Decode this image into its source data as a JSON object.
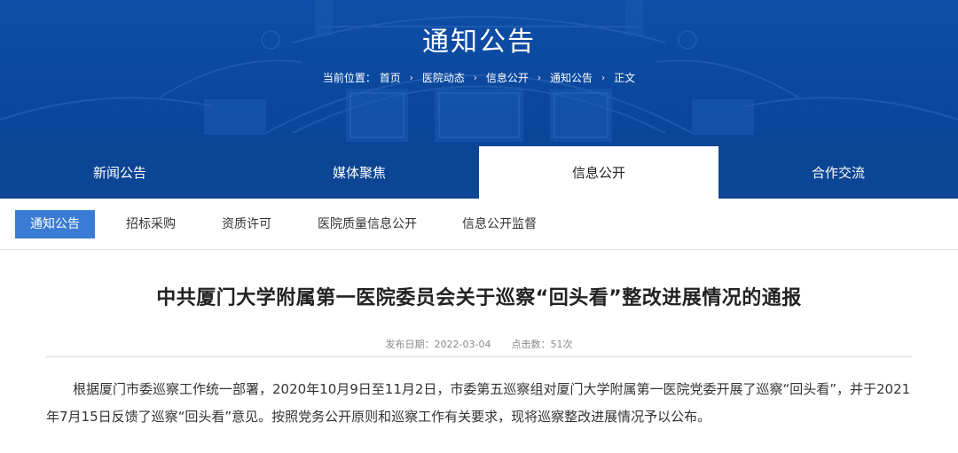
{
  "banner": {
    "title": "通知公告",
    "breadcrumb": {
      "prefix": "当前位置：",
      "items": [
        "首页",
        "医院动态",
        "信息公开",
        "通知公告",
        "正文"
      ]
    }
  },
  "main_nav": {
    "tabs": [
      {
        "label": "新闻公告",
        "active": false
      },
      {
        "label": "媒体聚焦",
        "active": false
      },
      {
        "label": "信息公开",
        "active": true
      },
      {
        "label": "合作交流",
        "active": false
      }
    ]
  },
  "sub_nav": {
    "tabs": [
      {
        "label": "通知公告",
        "active": true
      },
      {
        "label": "招标采购",
        "active": false
      },
      {
        "label": "资质许可",
        "active": false
      },
      {
        "label": "医院质量信息公开",
        "active": false
      },
      {
        "label": "信息公开监督",
        "active": false
      }
    ]
  },
  "article": {
    "title": "中共厦门大学附属第一医院委员会关于巡察“回头看”整改进展情况的通报",
    "publish_label": "发布日期：",
    "publish_date": "2022-03-04",
    "views_label": "点击数：",
    "views": "51次",
    "body": "根据厦门市委巡察工作统一部署，2020年10月9日至11月2日，市委第五巡察组对厦门大学附属第一医院党委开展了巡察“回头看”，并于2021年7月15日反馈了巡察“回头看”意见。按照党务公开原则和巡察工作有关要求，现将巡察整改进展情况予以公布。"
  },
  "colors": {
    "banner_blue": "#0b4aa0",
    "nav_blue": "#0c4593",
    "active_subtab": "#3a7bd5"
  }
}
